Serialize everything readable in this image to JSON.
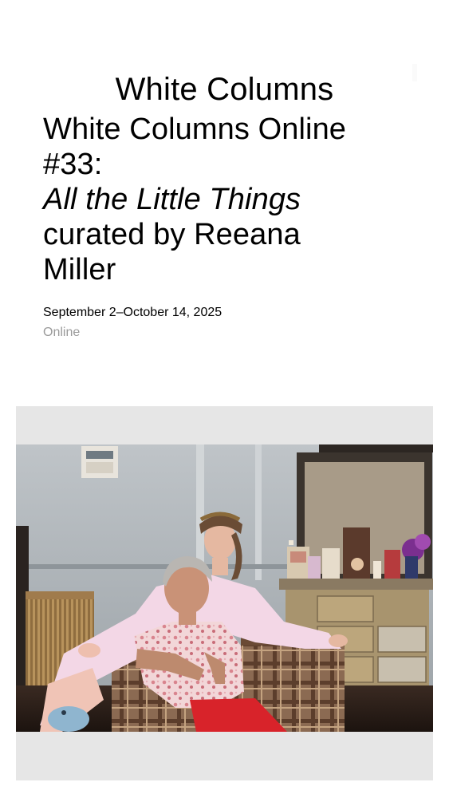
{
  "site": {
    "title": "White Columns"
  },
  "exhibition": {
    "title_line1": "White Columns Online",
    "title_line2": "#33:",
    "title_line3_italic": "All the Little Things",
    "title_line4": "curated by Reeana",
    "title_line5": "Miller",
    "dates": "September 2–October 14, 2025",
    "location": "Online"
  },
  "colors": {
    "text": "#000000",
    "muted": "#9a9a9a",
    "frame_background": "#e6e6e6"
  }
}
